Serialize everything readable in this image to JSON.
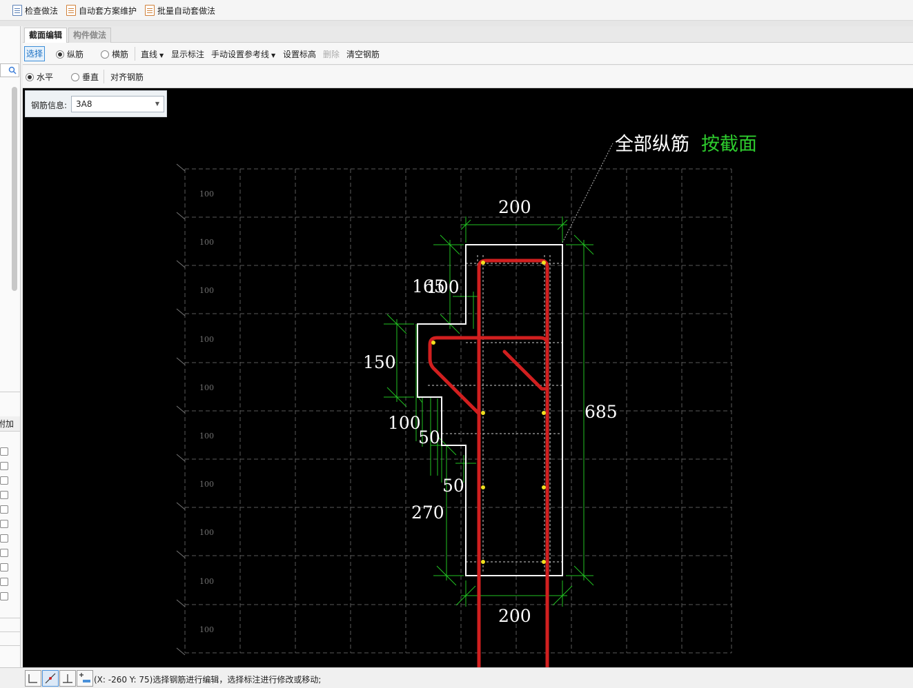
{
  "toolbar": {
    "check_method": "检查做法",
    "auto_scheme": "自动套方案维护",
    "batch_auto": "批量自动套做法"
  },
  "left_panel": {
    "header": "附加"
  },
  "tabs": {
    "section_edit": "截面编辑",
    "component_method": "构件做法"
  },
  "edit_toolbar": {
    "select": "选择",
    "longitudinal": "纵筋",
    "transverse": "横筋",
    "line": "直线",
    "show_annotation": "显示标注",
    "manual_reference": "手动设置参考线",
    "set_elevation": "设置标高",
    "delete": "删除",
    "clear_rebar": "清空钢筋"
  },
  "direction_toolbar": {
    "horizontal": "水平",
    "vertical": "垂直",
    "align_rebar": "对齐钢筋"
  },
  "rebar_info": {
    "label": "钢筋信息:",
    "value": "3A8"
  },
  "drawing": {
    "callout_white": "全部纵筋",
    "callout_green": "按截面",
    "grid_label": "100",
    "dimensions": {
      "top_width": "200",
      "bottom_width": "200",
      "height": "685",
      "d165": "165",
      "d100a": "100",
      "d150": "150",
      "d100b": "100",
      "d50a": "50",
      "d50b": "50",
      "d270": "270"
    },
    "colors": {
      "background": "#000000",
      "outline": "#ffffff",
      "dimension": "#22c322",
      "rebar": "#d11f1f",
      "point": "#f0e020",
      "grid": "#5a5a5a"
    }
  },
  "status": {
    "text": "(X: -260 Y: 75)选择钢筋进行编辑，选择标注进行修改或移动;"
  }
}
